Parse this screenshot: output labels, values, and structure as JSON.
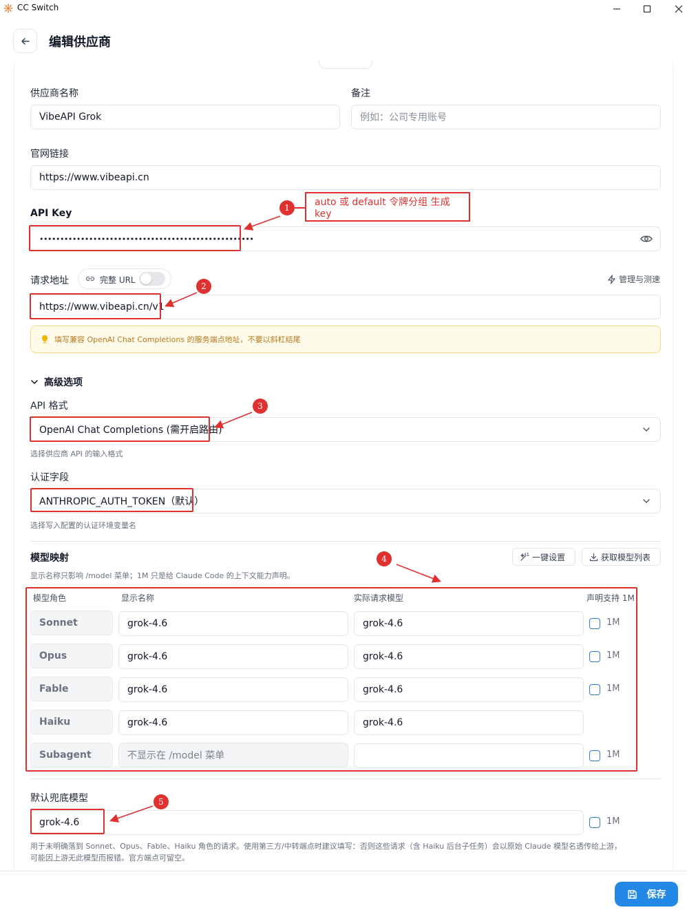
{
  "window": {
    "title": "CC Switch"
  },
  "header": {
    "title": "编辑供应商"
  },
  "form": {
    "provider_name": {
      "label": "供应商名称",
      "value": "VibeAPI Grok"
    },
    "note": {
      "label": "备注",
      "placeholder": "例如：公司专用账号"
    },
    "website": {
      "label": "官网链接",
      "value": "https://www.vibeapi.cn"
    },
    "api_key": {
      "label": "API Key",
      "value": "••••••••••••••••••••••••••••••••••••••••••••••••••••"
    },
    "request_url": {
      "label": "请求地址",
      "full_url_toggle_label": "完整 URL",
      "manage_label": "管理与测速",
      "value": "https://www.vibeapi.cn/v1",
      "warning": "填写兼容 OpenAI Chat Completions 的服务端点地址，不要以斜杠结尾"
    },
    "advanced": {
      "title": "高级选项",
      "api_format": {
        "label": "API 格式",
        "value": "OpenAI Chat Completions (需开启路由)",
        "hint": "选择供应商 API 的输入格式"
      },
      "auth_field": {
        "label": "认证字段",
        "value": "ANTHROPIC_AUTH_TOKEN（默认）",
        "hint": "选择写入配置的认证环境变量名"
      }
    },
    "model_mapping": {
      "title": "模型映射",
      "hint": "显示名称只影响 /model 菜单；1M 只是给 Claude Code 的上下文能力声明。",
      "one_click_label": "一键设置",
      "fetch_label": "获取模型列表",
      "columns": [
        "模型角色",
        "显示名称",
        "实际请求模型",
        "声明支持 1M"
      ],
      "rows": [
        {
          "role": "Sonnet",
          "display": "grok-4.6",
          "actual": "grok-4.6",
          "flag": "1M"
        },
        {
          "role": "Opus",
          "display": "grok-4.6",
          "actual": "grok-4.6",
          "flag": "1M"
        },
        {
          "role": "Fable",
          "display": "grok-4.6",
          "actual": "grok-4.6",
          "flag": "1M"
        },
        {
          "role": "Haiku",
          "display": "grok-4.6",
          "actual": "grok-4.6",
          "flag": ""
        },
        {
          "role": "Subagent",
          "display_placeholder": "不显示在 /model 菜单",
          "actual": "",
          "flag": "1M"
        }
      ]
    },
    "fallback": {
      "label": "默认兜底模型",
      "value": "grok-4.6",
      "flag": "1M",
      "hint_line1": "用于未明确落到 Sonnet、Opus、Fable、Haiku 角色的请求。使用第三方/中转端点时建议填写：否则这些请求（含 Haiku 后台子任务）会以原始 Claude 模型名透传给上游，",
      "hint_line2": "可能因上游无此模型而报错。官方端点可留空。"
    }
  },
  "annotations": {
    "callout_1": "auto 或 default 令牌分组 生成 key",
    "badges": [
      "1",
      "2",
      "3",
      "4",
      "5"
    ]
  },
  "footer": {
    "save_label": "保存"
  },
  "colors": {
    "accent": "#2388e6",
    "annotation": "#e03131",
    "warning_bg": "#fffbea",
    "warning_text": "#b7791f"
  }
}
